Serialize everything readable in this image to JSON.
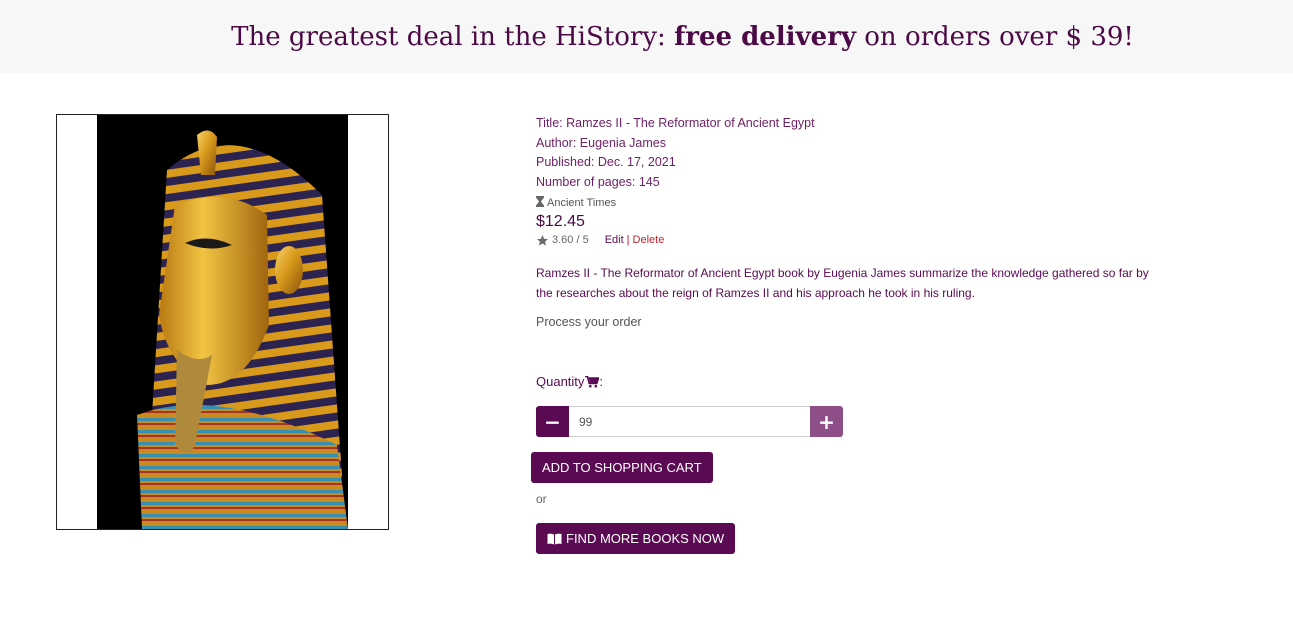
{
  "banner": {
    "text_before": "The greatest deal in the HiStory: ",
    "text_bold": "free delivery",
    "text_after": " on orders over $ 39!"
  },
  "book": {
    "image_alt": "Golden pharaoh mask",
    "title_line": "Title: Ramzes II - The Reformator of Ancient Egypt",
    "author_line": "Author: Eugenia James",
    "published_line": "Published: Dec. 17, 2021",
    "pages_line": "Number of pages: 145",
    "category": "Ancient Times",
    "price": "$12.45",
    "rating": "3.60 / 5",
    "edit_label": "Edit",
    "separator": "|",
    "delete_label": "Delete",
    "description": "Ramzes II - The Reformator of Ancient Egypt book by Eugenia James summarize the knowledge gathered so far by the researches about the reign of Ramzes II and his approach he took in his ruling."
  },
  "order": {
    "process_label": "Process your order",
    "quantity_label": "Quantity",
    "quantity_suffix": ":",
    "quantity_value": "99",
    "minus_label": "−",
    "plus_label": "+",
    "add_to_cart_label": "ADD TO SHOPPING CART",
    "or_label": "or",
    "find_more_label": "FIND MORE BOOKS NOW"
  },
  "icons": {
    "category": "hourglass-icon",
    "rating": "star-icon",
    "quantity": "shopping-cart-icon",
    "find_more": "open-book-icon"
  },
  "colors": {
    "brand": "#5a0a52",
    "plus_button": "#8e4f89",
    "delete_link": "#c0262b"
  }
}
